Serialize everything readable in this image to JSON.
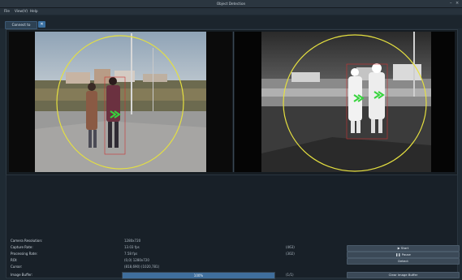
{
  "window": {
    "title": "Object Detection",
    "controls": [
      "–",
      "×"
    ]
  },
  "menu": [
    "File",
    "View(V)",
    "Help"
  ],
  "toolbar": {
    "connect_label": "Connect to Camera...",
    "icon_glyph": "✕"
  },
  "stats": {
    "camera_resolution_label": "Camera Resolution:",
    "camera_resolution_value": "1280x720",
    "capture_rate_label": "Capture Rate:",
    "capture_rate_value": "13.03 fps",
    "capture_rate_count": "(463)",
    "processing_rate_label": "Processing Rate:",
    "processing_rate_value": "7.58 fps",
    "processing_rate_count": "(302)",
    "roi_label": "ROI:",
    "roi_value": "(0,0) 1280x720",
    "cursor_label": "Cursor:",
    "cursor_value": "(818,690) (1020,781)",
    "image_buffer_label": "Image Buffer:",
    "image_buffer_text": "100%",
    "image_buffer_percent": 100,
    "image_buffer_count": "(1/1)"
  },
  "actions": {
    "start": "▶ Start",
    "pause": "❚❚ Pause",
    "detect": "Detect",
    "clear": "Clear Image Buffer"
  },
  "icons": {
    "toolbar_icon": "close-icon"
  }
}
